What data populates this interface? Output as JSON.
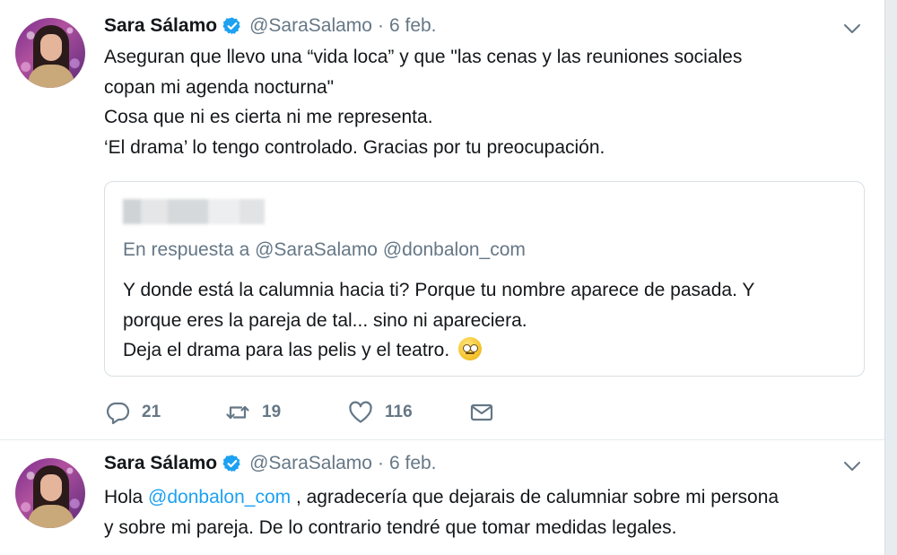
{
  "tweets": [
    {
      "author": {
        "name": "Sara Sálamo",
        "handle": "@SaraSalamo",
        "verified": true
      },
      "separator": "·",
      "time": "6 feb.",
      "text_lines": [
        "Aseguran que llevo una “vida loca” y que \"las cenas y las reuniones sociales",
        "copan mi agenda nocturna\"",
        "Cosa que ni es cierta ni me representa.",
        "‘El drama’ lo tengo controlado. Gracias por tu preocupación."
      ],
      "quoted": {
        "reply_prefix": "En respuesta a",
        "reply_handles": "@SaraSalamo @donbalon_com",
        "text_lines": [
          "Y donde está la calumnia hacia ti? Porque tu nombre aparece de pasada. Y",
          "porque eres la pareja de tal... sino ni apareciera.",
          "Deja el drama para las pelis y el teatro."
        ],
        "emoji": "face-with-rolling-eyes"
      },
      "actions": {
        "replies": "21",
        "retweets": "19",
        "likes": "116"
      }
    },
    {
      "author": {
        "name": "Sara Sálamo",
        "handle": "@SaraSalamo",
        "verified": true
      },
      "separator": "·",
      "time": "6 feb.",
      "text_line1_prefix": "Hola ",
      "text_mention": "@donbalon_com",
      "text_line1_suffix": " , agradecería que dejarais de calumniar sobre mi persona",
      "text_line2": "y sobre mi pareja. De lo contrario tendré que tomar medidas legales."
    }
  ],
  "colors": {
    "accent": "#1da1f2",
    "secondary_text": "#657786",
    "primary_text": "#14171a"
  },
  "icons": [
    "verified-badge-icon",
    "caret-down-icon",
    "reply-icon",
    "retweet-icon",
    "heart-icon",
    "direct-message-icon"
  ]
}
